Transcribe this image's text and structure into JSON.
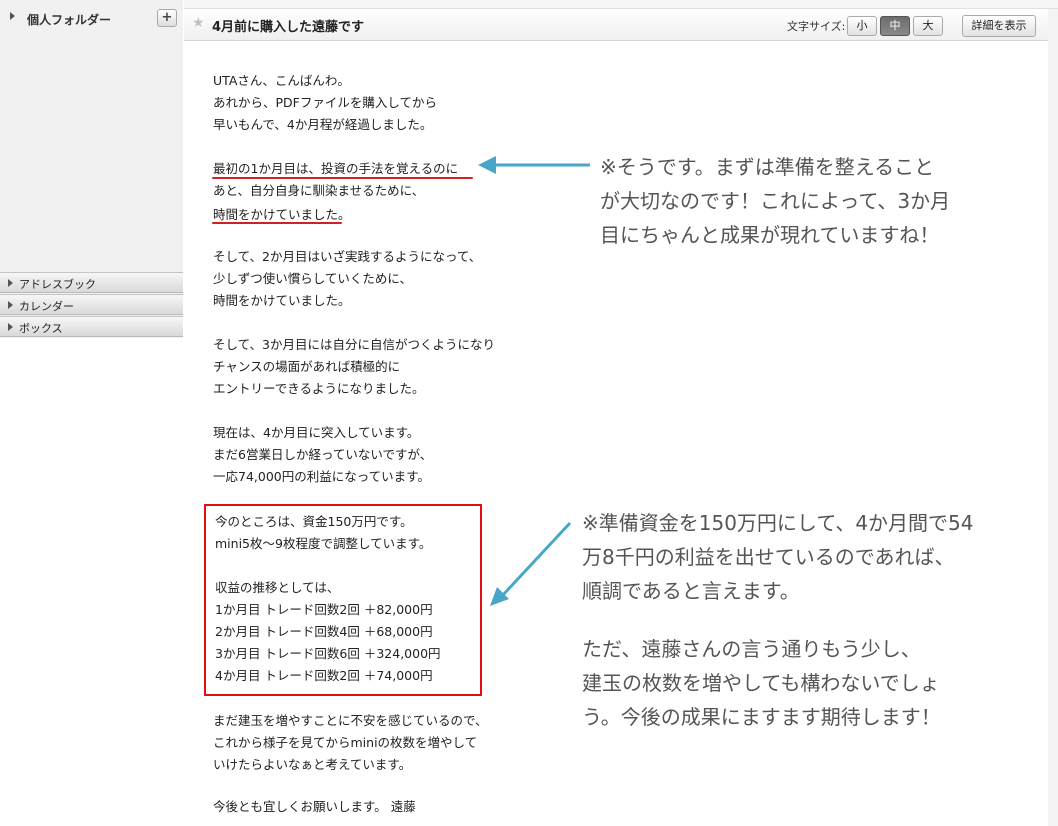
{
  "sidebar": {
    "personal_folder": "個人フォルダー",
    "add_button": "+",
    "sections": [
      {
        "label": "アドレスブック"
      },
      {
        "label": "カレンダー"
      },
      {
        "label": "ボックス"
      }
    ]
  },
  "header": {
    "subject": "4月前に購入した遠藤です",
    "font_size_label": "文字サイズ:",
    "font_sizes": [
      "小",
      "中",
      "大"
    ],
    "active_font_size": "中",
    "details_button": "詳細を表示"
  },
  "message": {
    "lines": [
      "UTAさん、こんばんわ。",
      "あれから、PDFファイルを購入してから",
      "早いもんで、4か月程が経過しました。",
      "最初の1か月目は、投資の手法を覚えるのに",
      "あと、自分自身に馴染ませるために、",
      "時間をかけていました。",
      "そして、2か月目はいざ実践するようになって、",
      "少しずつ使い慣らしていくために、",
      "時間をかけていました。",
      "そして、3か月目には自分に自信がつくようになり",
      "チャンスの場面があれば積極的に",
      "エントリーできるようになりました。",
      "現在は、4か月目に突入しています。",
      "まだ6営業日しか経っていないですが、",
      "一応74,000円の利益になっています。",
      "今のところは、資金150万円です。",
      "mini5枚〜9枚程度で調整しています。",
      "収益の推移としては、",
      "1か月目  トレード回数2回   ＋82,000円",
      "2か月目  トレード回数4回   ＋68,000円",
      "3か月目  トレード回数6回   ＋324,000円",
      "4か月目  トレード回数2回   ＋74,000円",
      "まだ建玉を増やすことに不安を感じているので、",
      "これから様子を見てからminiの枚数を増やして",
      "いけたらよいなぁと考えています。",
      "今後とも宜しくお願いします。  遠藤"
    ]
  },
  "annotations": {
    "comment1": [
      "※そうです。まずは準備を整えること",
      "が大切なのです！これによって、3か月",
      "目にちゃんと成果が現れていますね！"
    ],
    "comment2": [
      "※準備資金を150万円にして、4か月間で54",
      "万8千円の利益を出せているのであれば、",
      "順調であると言えます。",
      "ただ、遠藤さんの言う通りもう少し、",
      "建玉の枚数を増やしても構わないでしょ",
      "う。今後の成果にますます期待します！"
    ],
    "arrow_color": "#4aa6c8",
    "highlight_color": "#e01010"
  }
}
